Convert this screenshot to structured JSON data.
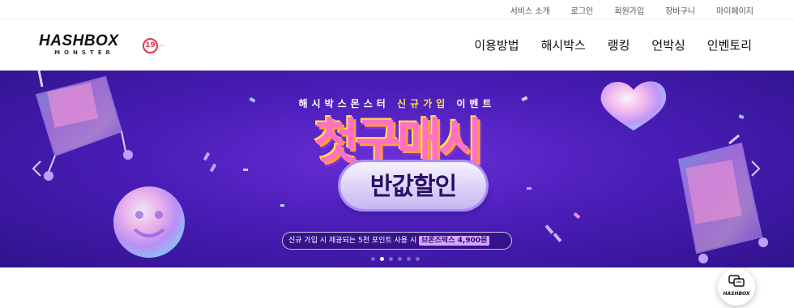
{
  "topbar": {
    "links": [
      "서비스 소개",
      "로그인",
      "회원가입",
      "장바구니",
      "마이페이지"
    ]
  },
  "header": {
    "logo_main": "HASHBOX",
    "logo_sub": "MONSTER",
    "age_badge": "19",
    "nav": [
      "이용방법",
      "해시박스",
      "랭킹",
      "언박싱",
      "인벤토리"
    ]
  },
  "banner": {
    "kicker_pre": "해시박스몬스터",
    "kicker_highlight": "신규가입",
    "kicker_post": "이벤트",
    "headline": "첫구매시",
    "pill": "반값할인",
    "info_text": "신규 가입 시 제공되는 5천 포인트 사용 시",
    "info_emphasis": "브론즈박스 4,900원",
    "slide_count": 6,
    "active_slide": 2,
    "colors": {
      "bg": "#4a1db8",
      "accent_yellow": "#ffe34a",
      "accent_pink": "#ff6ec7"
    }
  },
  "chat_widget": {
    "label": "HASHBOX",
    "icon": "chat-bubbles-icon"
  }
}
